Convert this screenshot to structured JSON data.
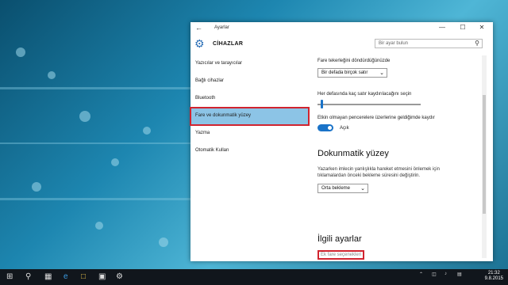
{
  "window": {
    "title": "Ayarlar",
    "back_icon": "back-arrow-icon",
    "minimize": "—",
    "maximize": "☐",
    "close": "✕"
  },
  "header": {
    "title": "CİHAZLAR",
    "icon": "gear-icon",
    "search_placeholder": "Bir ayar bulun"
  },
  "sidebar": {
    "items": [
      {
        "label": "Yazıcılar ve tarayıcılar"
      },
      {
        "label": "Bağlı cihazlar"
      },
      {
        "label": "Bluetooth"
      },
      {
        "label": "Fare ve dokunmatik yüzey"
      },
      {
        "label": "Yazma"
      },
      {
        "label": "Otomatik Kullan"
      }
    ],
    "active_index": 3
  },
  "main": {
    "wheel_label": "Fare tekerleğini döndürdüğünüzde",
    "wheel_value": "Bir defada birçok satır",
    "lines_label": "Her defasında kaç satır kaydırılacağını seçin",
    "lines_level": 0.03,
    "inactive_label": "Etkin olmayan pencerelere üzerlerine geldiğimde kaydır",
    "toggle_state": "Açık",
    "touchpad_heading": "Dokunmatik yüzey",
    "touchpad_note": "Yazarken imlecin yanlışlıkla hareket etmesini önlemek için tıklamalardan önceki bekleme süresini değiştirin.",
    "delay_value": "Orta bekleme",
    "related_heading": "İlgili ayarlar",
    "related_link": "Ek fare seçenekleri"
  },
  "taskbar": {
    "start_icon": "windows-start-icon",
    "search_icon": "search-icon",
    "taskview_icon": "task-view-icon",
    "apps": [
      "edge-icon",
      "explorer-icon",
      "store-icon",
      "settings-icon"
    ],
    "time": "21:32",
    "date": "9.8.2015"
  },
  "colors": {
    "accent": "#1a73c8",
    "highlight": "#d1242f",
    "active_item": "#8cc4e6"
  }
}
